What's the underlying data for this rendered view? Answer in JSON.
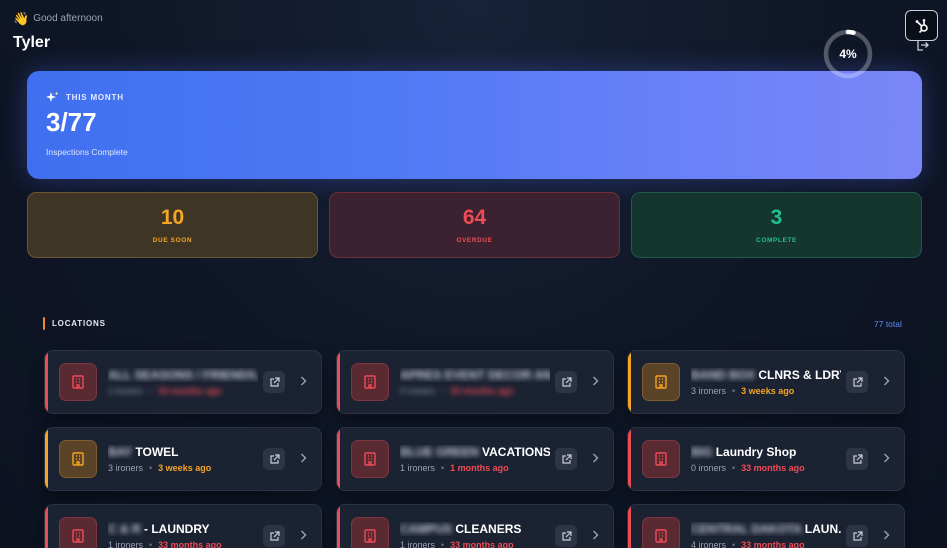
{
  "header": {
    "greeting_emoji": "👋",
    "greeting": "Good afternoon",
    "user_name": "Tyler",
    "hub_icon": "hubspot-icon",
    "logout_icon": "logout-icon"
  },
  "hero": {
    "label": "THIS MONTH",
    "value": "3/77",
    "subtitle": "Inspections Complete",
    "progress_label": "4%",
    "progress_fraction": 0.04,
    "colors": {
      "from": "#3f6ff0",
      "to": "#7b86f7"
    }
  },
  "stats": [
    {
      "value": "10",
      "label": "DUE SOON",
      "color": "#f5a524"
    },
    {
      "value": "64",
      "label": "OVERDUE",
      "color": "#ef4b55"
    },
    {
      "value": "3",
      "label": "COMPLETE",
      "color": "#22c08b"
    }
  ],
  "locations": {
    "title": "LOCATIONS",
    "total": "77 total",
    "items": [
      {
        "name_blurred": "ALL SEASONS / FRIENDS...",
        "name": "",
        "ironers": "1 ironers",
        "ago": "33 months ago",
        "meta_blurred": true,
        "status": "overdue"
      },
      {
        "name_blurred": "APRES EVENT DECOR AN...",
        "name": "",
        "ironers": "0 ironers",
        "ago": "33 months ago",
        "meta_blurred": true,
        "status": "overdue"
      },
      {
        "name_blurred": "BAND BOX",
        "name": "CLNRS & LDRY",
        "ironers": "3 ironers",
        "ago": "3 weeks ago",
        "meta_blurred": false,
        "status": "due-soon"
      },
      {
        "name_blurred": "BAY",
        "name": "TOWEL",
        "ironers": "3 ironers",
        "ago": "3 weeks ago",
        "meta_blurred": false,
        "status": "due-soon"
      },
      {
        "name_blurred": "BLUE GREEN",
        "name": "VACATIONS",
        "ironers": "1 ironers",
        "ago": "1 months ago",
        "meta_blurred": false,
        "status": "overdue"
      },
      {
        "name_blurred": "BIG",
        "name": "Laundry Shop",
        "ironers": "0 ironers",
        "ago": "33 months ago",
        "meta_blurred": false,
        "status": "overdue"
      },
      {
        "name_blurred": "C & R",
        "name": "- LAUNDRY",
        "ironers": "1 ironers",
        "ago": "33 months ago",
        "meta_blurred": false,
        "status": "overdue"
      },
      {
        "name_blurred": "CAMPUS",
        "name": "CLEANERS",
        "ironers": "1 ironers",
        "ago": "33 months ago",
        "meta_blurred": false,
        "status": "overdue"
      },
      {
        "name_blurred": "CENTRAL DAKOTA",
        "name": "LAUN...",
        "ironers": "4 ironers",
        "ago": "33 months ago",
        "meta_blurred": false,
        "status": "overdue"
      }
    ]
  }
}
